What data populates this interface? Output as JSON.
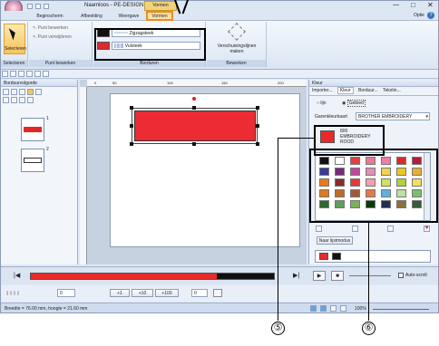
{
  "app": {
    "title": "Naamloos - PE-DESIGN PLUS2",
    "context_tab": "Vormen",
    "help_label": "Optie"
  },
  "tabs": [
    "Beginscherm",
    "Afbeelding",
    "Weergave",
    "Vormen"
  ],
  "ribbon": {
    "select_label": "Selecteren",
    "point_edit": "Punt bewerken",
    "point_delete": "Punt verwijderen",
    "line_style": "Zigzagsteek",
    "fill_style": "Vulsteek",
    "shift_label": "Verschuivingslijnen maken",
    "groups": [
      "Selecteren",
      "Punt bewerken",
      "Borduren",
      "Bewerken"
    ]
  },
  "left_panel": {
    "title": "Borduurvolgorde",
    "item_numbers": [
      "1",
      "2"
    ]
  },
  "ruler": {
    "ticks": [
      "0",
      "50",
      "100",
      "150",
      "200"
    ]
  },
  "right_panel": {
    "title": "Kleur",
    "tabs": [
      "Importer...",
      "Kleur",
      "Borduur...",
      "Tekstin..."
    ],
    "radio_line": "lijn",
    "radio_area": "Gebied",
    "chart_label": "Garenkleurkaart",
    "chart_value": "BROTHER EMBROIDERY",
    "selected_code": "800",
    "selected_brand": "EMBROIDERY",
    "selected_name": "ROOD",
    "list_mode_button": "Naar lijstmodus",
    "auto_scroll": "Auto-scroll",
    "palette": [
      [
        "#111111",
        "#ffffff",
        "#e04040",
        "#e87a9a",
        "#f07ca8",
        "#d82b2b",
        "#b01d3f",
        "#e03a2a"
      ],
      [
        "#3a3a9a",
        "#7a2a7a",
        "#c04a9a",
        "#e090b0",
        "#f4d24a",
        "#e8c820",
        "#e8b030",
        "#f0dc70"
      ],
      [
        "#f07a1a",
        "#8a2a2a",
        "#e03a3a",
        "#f0a0b0",
        "#d0e060",
        "#b0d040",
        "#f0e060",
        "#f0f0a0"
      ],
      [
        "#e07a1a",
        "#c06a2a",
        "#a05a3a",
        "#e07a4a",
        "#60b0e0",
        "#c0e0a0",
        "#7ac070",
        "#e8c0d0"
      ],
      [
        "#2a6a2a",
        "#5aa05a",
        "#7ab060",
        "#0a3a0a",
        "#203050",
        "#8a7040",
        "#3a5a3a",
        "#a0c090"
      ]
    ]
  },
  "status": {
    "size_text": "Breedte = 76.00 mm, hoogte = 21.60 mm",
    "zoom": "100%"
  },
  "bottom": {
    "fields": [
      "0",
      "+1",
      "+10",
      "+100",
      "0"
    ]
  },
  "callouts": {
    "five": "⑤",
    "six": "⑥"
  }
}
